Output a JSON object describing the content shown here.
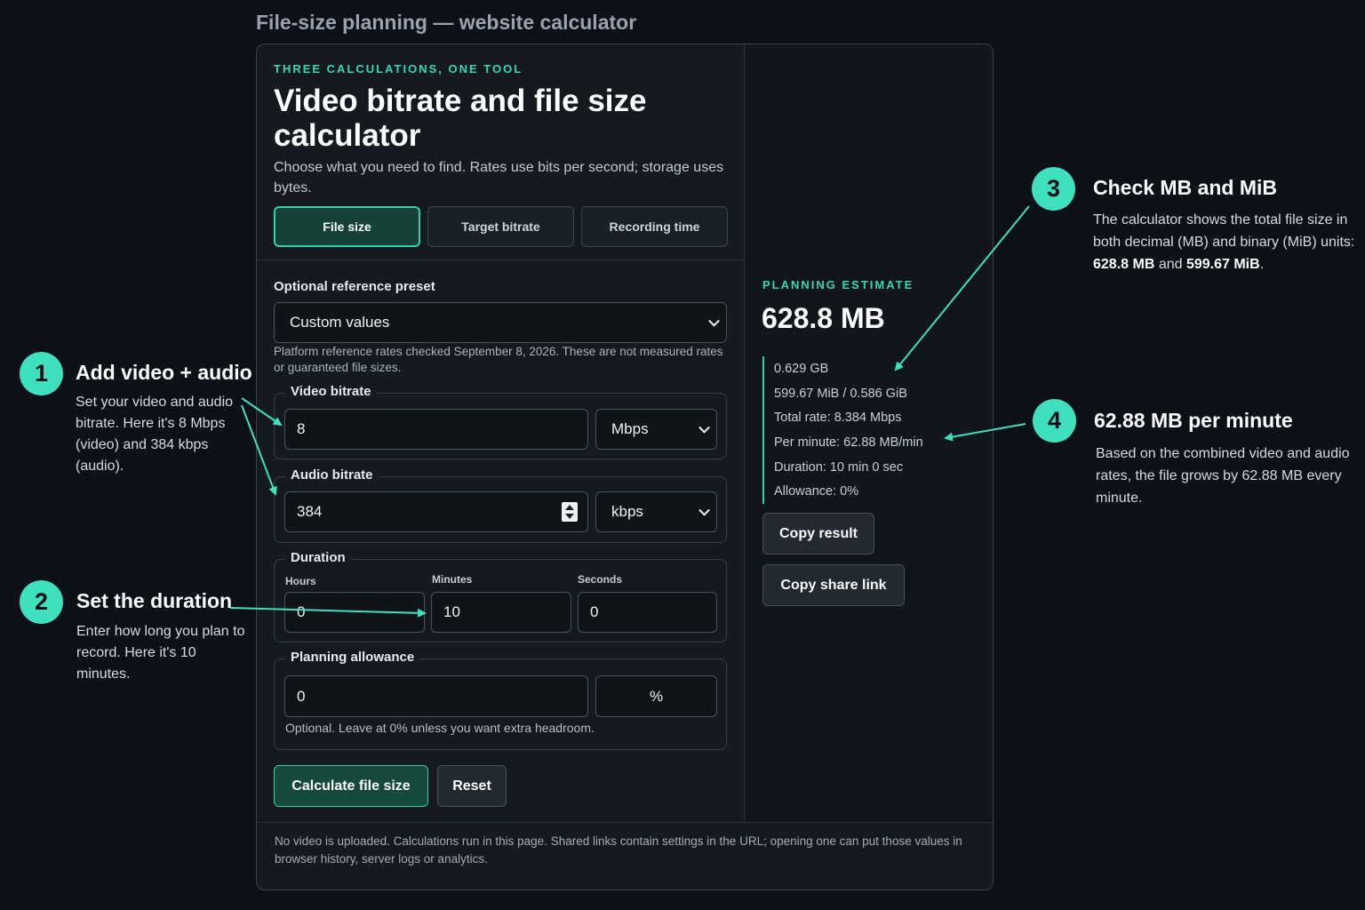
{
  "page": {
    "heading": "File-size planning — website calculator"
  },
  "header": {
    "eyebrow": "THREE CALCULATIONS, ONE TOOL",
    "title": "Video bitrate and file size calculator",
    "subtitle": "Choose what you need to find. Rates use bits per second; storage uses bytes."
  },
  "tabs": [
    {
      "label": "File size",
      "active": true
    },
    {
      "label": "Target bitrate",
      "active": false
    },
    {
      "label": "Recording time",
      "active": false
    }
  ],
  "preset": {
    "label": "Optional reference preset",
    "selected": "Custom values",
    "note": "Platform reference rates checked September 8, 2026. These are not measured rates or guaranteed file sizes."
  },
  "video_bitrate": {
    "legend": "Video bitrate",
    "value": "8",
    "unit": "Mbps"
  },
  "audio_bitrate": {
    "legend": "Audio bitrate",
    "value": "384",
    "unit": "kbps"
  },
  "duration": {
    "legend": "Duration",
    "hours_label": "Hours",
    "hours": "0",
    "minutes_label": "Minutes",
    "minutes": "10",
    "seconds_label": "Seconds",
    "seconds": "0"
  },
  "allowance": {
    "legend": "Planning allowance",
    "value": "0",
    "unit": "%",
    "hint": "Optional. Leave at 0% unless you want extra headroom."
  },
  "actions": {
    "calculate": "Calculate file size",
    "reset": "Reset"
  },
  "estimate": {
    "label": "PLANNING ESTIMATE",
    "value": "628.8 MB",
    "details": [
      "0.629 GB",
      "599.67 MiB / 0.586 GiB",
      "Total rate: 8.384 Mbps",
      "Per minute: 62.88 MB/min",
      "Duration: 10 min 0 sec",
      "Allowance: 0%"
    ],
    "copy_result": "Copy result",
    "copy_link": "Copy share link"
  },
  "footer": "No video is uploaded. Calculations run in this page. Shared links contain settings in the URL; opening one can put those values in browser history, server logs or analytics.",
  "callouts": [
    {
      "number": "1",
      "title": "Add video + audio",
      "text": "Set your video and audio bitrate. Here it's 8 Mbps (video) and 384 kbps (audio)."
    },
    {
      "number": "2",
      "title": "Set the duration",
      "text": "Enter how long you plan to record. Here it's 10 minutes."
    },
    {
      "number": "3",
      "title": "Check MB and MiB",
      "text_prefix": "The calculator shows the total file size in both decimal (MB) and binary (MiB) units: ",
      "text_b1": "628.8 MB",
      "text_mid": " and ",
      "text_b2": "599.67 MiB",
      "text_suffix": "."
    },
    {
      "number": "4",
      "title": "62.88 MB per minute",
      "text": "Based on the combined video and audio rates, the file grows by 62.88 MB every minute."
    }
  ],
  "colors": {
    "accent": "#3ad6b3",
    "background": "#0c1017",
    "card": "#141a20"
  }
}
